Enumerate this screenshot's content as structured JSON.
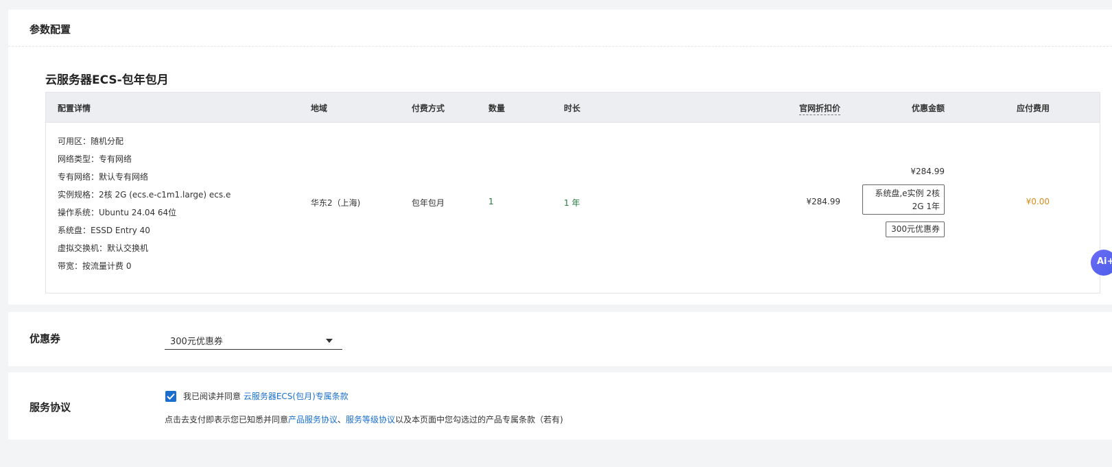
{
  "config_section": {
    "title": "参数配置",
    "product_title": "云服务器ECS-包年包月",
    "table": {
      "headers": {
        "detail": "配置详情",
        "region": "地域",
        "payment": "付费方式",
        "quantity": "数量",
        "duration": "时长",
        "list_price": "官网折扣价",
        "discount": "优惠金额",
        "payable": "应付费用"
      },
      "row": {
        "details": [
          "可用区：随机分配",
          "网络类型：专有网络",
          "专有网络：默认专有网络",
          "实例规格：2核 2G (ecs.e-c1m1.large) ecs.e",
          "操作系统：Ubuntu 24.04 64位",
          "系统盘：ESSD Entry 40",
          "虚拟交换机：默认交换机",
          "带宽：按流量计费 0"
        ],
        "region": "华东2（上海)",
        "payment": "包年包月",
        "quantity": "1",
        "duration": "1 年",
        "list_price": "¥284.99",
        "discount_amount": "¥284.99",
        "discount_tag_line1": "系统盘,e实例 2核",
        "discount_tag_line2": "2G 1年",
        "coupon_tag": "300元优惠券",
        "payable": "¥0.00"
      }
    }
  },
  "coupon_section": {
    "title": "优惠券",
    "selected": "300元优惠券"
  },
  "terms_section": {
    "title": "服务协议",
    "agree_text": "我已阅读并同意",
    "agree_link": "云服务器ECS(包月)专属条款",
    "notice_prefix": "点击去支付即表示您已知悉并同意",
    "notice_link1": "产品服务协议",
    "notice_sep": "、",
    "notice_link2": "服务等级协议",
    "notice_suffix": "以及本页面中您勾选过的产品专属条款（若有)"
  },
  "ai_button": {
    "label": "Ai+"
  },
  "colors": {
    "accent": "#1a6fce",
    "green": "#1d7a3a",
    "orange": "#d98b1c"
  },
  "icons": [
    "check-icon",
    "caret-down-icon",
    "ai-assistant-icon"
  ]
}
